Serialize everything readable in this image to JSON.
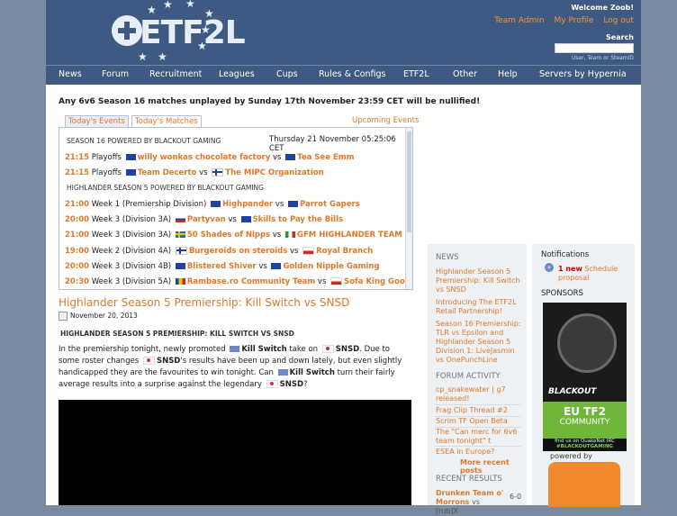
{
  "header": {
    "logo": "ETF2L",
    "welcome": "Welcome Zoob!",
    "links": [
      "Team Admin",
      "My Profile",
      "Log out"
    ],
    "search_label": "Search",
    "search_hint": "User, Team or SteamID"
  },
  "nav": [
    "News",
    "Forum",
    "Recruitment",
    "Leagues",
    "Cups",
    "Rules & Configs",
    "ETF2L",
    "Other",
    "Help",
    "Servers by Hypernia"
  ],
  "notice": "Any 6v6 Season 16 matches unplayed by Sunday 17th November 23:59 CET will be nullified!",
  "tabs": {
    "events": "Today's Events",
    "matches": "Today's Matches",
    "upcoming": "Upcoming Events"
  },
  "events": {
    "section1": "SEASON 16 POWERED BY BLACKOUT GAMING",
    "date": "Thursday 21 November 05:25:06 CET",
    "section2": "HIGHLANDER SEASON 5 POWERED BY BLACKOUT GAMING",
    "rows": [
      {
        "time": "21:15",
        "label": "",
        "team1": "willy wonkas chocolate factory",
        "team2": "Tea See Emm"
      },
      {
        "time": "21:15",
        "label": "Playoffs",
        "team1": "Team Decerto",
        "team2": "The MIPC Organization"
      },
      {
        "time": "21:00",
        "label": "Week 1 (Premiership Division)",
        "team1": "Highpander",
        "team2": "Parrot Gapers"
      },
      {
        "time": "20:00",
        "label": "Week 3 (Division 3A)",
        "team1": "Partyvan",
        "team2": "Skills to Pay the Bills"
      },
      {
        "time": "21:00",
        "label": "Week 3 (Division 3A)",
        "team1": "50 Shades of Nipps",
        "team2": "GFM HIGHLANDER TEAM"
      },
      {
        "time": "19:00",
        "label": "Week 2 (Division 4A)",
        "team1": "Burgeroids on steroids",
        "team2": "Royal Branch"
      },
      {
        "time": "20:00",
        "label": "Week 3 (Division 4B)",
        "team1": "Blistered Shiver",
        "team2": "Golden Nipple Gaming"
      },
      {
        "time": "20:30",
        "label": "Week 3 (Division 5A)",
        "team1": "Rambase.ro Community Team",
        "team2": "Sofa King Good"
      }
    ],
    "vs": "vs",
    "playoffs": "Playoffs"
  },
  "article": {
    "title": "Highlander Season 5 Premiership: Kill Switch vs SNSD",
    "date": "November 20, 2013",
    "subtitle": "HIGHLANDER SEASON 5 PREMIERSHIP: KILL SWITCH VS SNSD",
    "p1": "In the premiership tonight, newly promoted",
    "ks": "Kill Switch",
    "p2": "take on",
    "snsd": "SNSD",
    "p3": ". Due to some roster changes",
    "p4": "'s results have been up and down lately, but even slightly handicapped they are the favourites to win tonight. Can",
    "p5": "turn their fairly average results into a surprise against the legendary",
    "p6": "?"
  },
  "news": {
    "heading": "NEWS",
    "items": [
      "Highlander Season 5 Premiership: Kill Switch vs SNSD",
      "Introducing The ETF2L Retail Partnership!",
      "Season 16 Premiership: TLR vs Epsilon and Highlander Season 5 Division 1: LiveJasmin vs OnePunchLine"
    ]
  },
  "forum": {
    "heading": "FORUM ACTIVITY",
    "items": [
      "cp_snakewater | g7 released!",
      "Frag Clip Thread #2",
      "Scrim TF Open Beta",
      "The \"Can merc for 6v6 team tonight\" t",
      "ESEA in Europe?"
    ],
    "more": "More recent posts"
  },
  "results": {
    "heading": "RECENT RESULTS",
    "team1": "Drunken Team o'",
    "team2": "Morrons",
    "vs": "vs",
    "opp": "[rub]X",
    "score": "6-0"
  },
  "notifications": {
    "heading": "Notifications",
    "count": "1 new",
    "label": "Schedule proposal"
  },
  "sponsors": {
    "heading": "SPONSORS",
    "brand": "BLACKOUT",
    "line1": "EU TF2",
    "line2": "COMMUNITY",
    "irc1": "find us on QuakeNet IRC",
    "irc2": "#BLACKOUTGAMING",
    "powered": "powered by"
  }
}
